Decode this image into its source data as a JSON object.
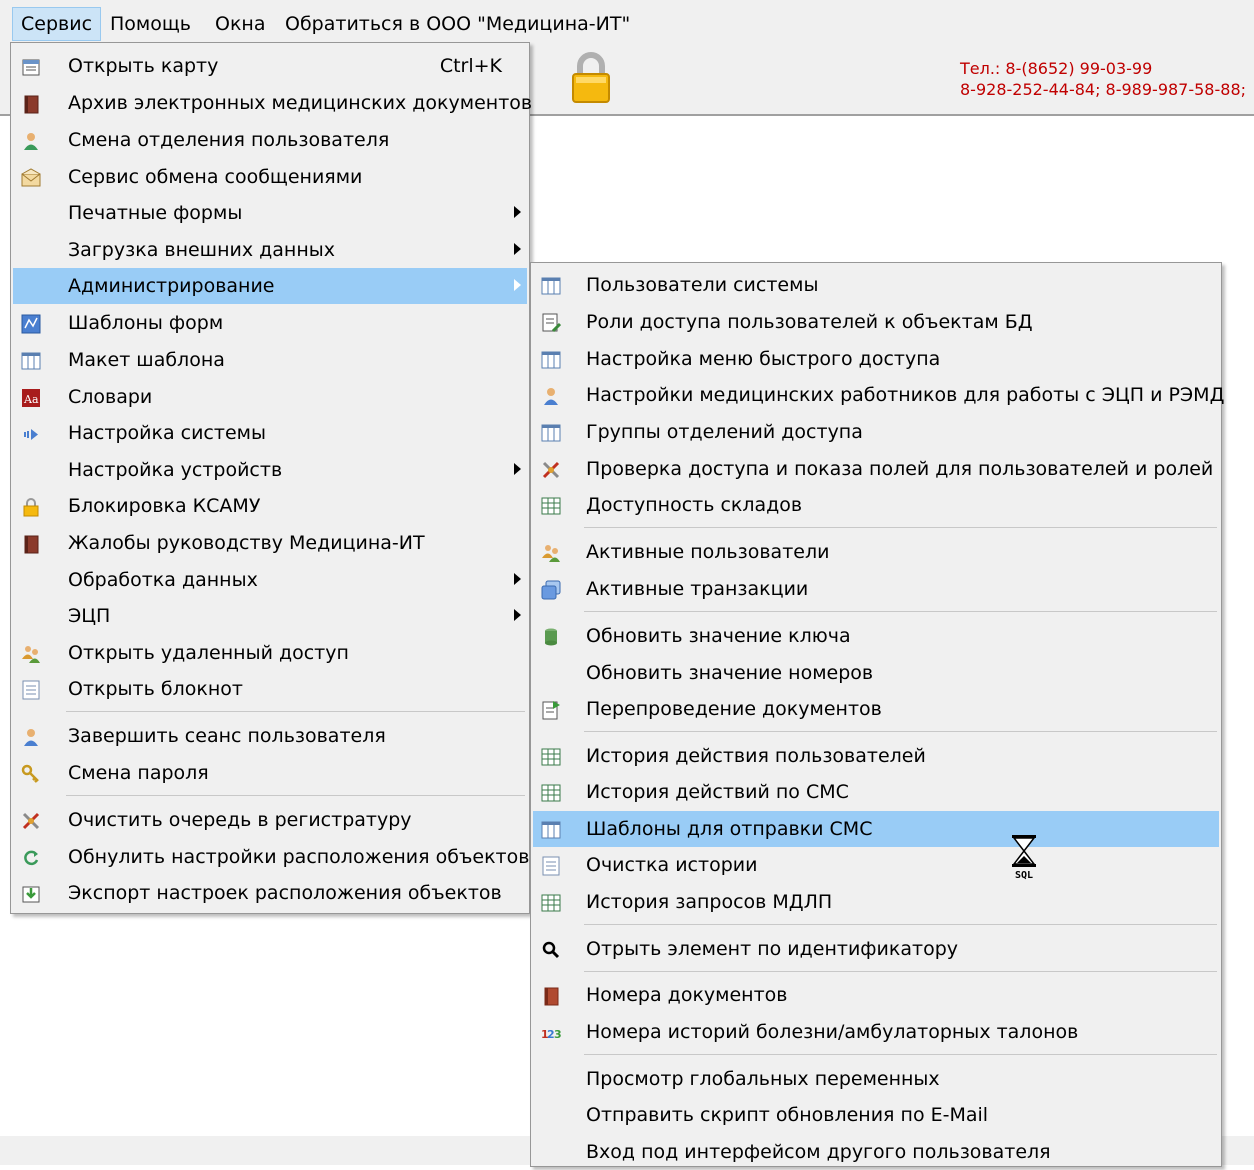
{
  "menubar": {
    "items": [
      "Сервис",
      "Помощь",
      "Окна",
      "Обратиться в ООО \"Медицина-ИТ\""
    ]
  },
  "contact": {
    "line1": "Тел.: 8-(8652) 99-03-99",
    "line2": "8-928-252-44-84; 8-989-987-58-88;"
  },
  "main_menu": {
    "items": [
      {
        "label": "Открыть карту",
        "shortcut": "Ctrl+K",
        "icon": "open-card-icon"
      },
      {
        "label": "Архив электронных медицинских документов",
        "icon": "book-icon"
      },
      {
        "label": "Смена отделения пользователя",
        "icon": "user-icon"
      },
      {
        "label": "Сервис обмена сообщениями",
        "icon": "envelope-icon"
      },
      {
        "label": "Печатные формы",
        "submenu": true
      },
      {
        "label": "Загрузка внешних данных",
        "submenu": true
      },
      {
        "label": "Администрирование",
        "submenu": true,
        "highlighted": true
      },
      {
        "label": "Шаблоны форм",
        "icon": "form-template-icon"
      },
      {
        "label": "Макет шаблона",
        "icon": "grid-icon"
      },
      {
        "label": "Словари",
        "icon": "dictionary-icon"
      },
      {
        "label": "Настройка системы",
        "icon": "arrow-right-icon"
      },
      {
        "label": "Настройка устройств",
        "submenu": true
      },
      {
        "label": "Блокировка КСАМУ",
        "icon": "lock-icon"
      },
      {
        "label": "Жалобы руководству Медицина-ИТ",
        "icon": "book-icon"
      },
      {
        "label": "Обработка данных",
        "submenu": true
      },
      {
        "label": "ЭЦП",
        "submenu": true
      },
      {
        "label": "Открыть удаленный доступ",
        "icon": "users-icon"
      },
      {
        "label": "Открыть блокнот",
        "icon": "notepad-icon"
      },
      {
        "label": "Завершить сеанс пользователя",
        "icon": "user-icon"
      },
      {
        "label": "Смена пароля",
        "icon": "key-icon"
      },
      {
        "label": "Очистить очередь в регистратуру",
        "icon": "tools-icon"
      },
      {
        "label": "Обнулить настройки расположения объектов",
        "icon": "refresh-icon"
      },
      {
        "label": "Экспорт настроек расположения объектов",
        "icon": "export-icon"
      }
    ]
  },
  "admin_submenu": {
    "items": [
      {
        "label": "Пользователи системы",
        "icon": "grid-icon"
      },
      {
        "label": "Роли доступа пользователей к объектам БД",
        "icon": "edit-doc-icon"
      },
      {
        "label": "Настройка меню быстрого доступа",
        "icon": "grid-icon"
      },
      {
        "label": "Настройки медицинских работников для работы с ЭЦП и РЭМД",
        "icon": "user-icon"
      },
      {
        "label": "Группы отделений доступа",
        "icon": "grid-icon"
      },
      {
        "label": "Проверка доступа и показа полей для пользователей и ролей",
        "icon": "tools-icon"
      },
      {
        "label": "Доступность складов",
        "icon": "table-icon"
      },
      {
        "label": "Активные пользователи",
        "icon": "users-icon"
      },
      {
        "label": "Активные транзакции",
        "icon": "windows-icon"
      },
      {
        "label": "Обновить значение ключа",
        "icon": "database-icon"
      },
      {
        "label": "Обновить значение номеров"
      },
      {
        "label": "Перепроведение документов",
        "icon": "repost-icon"
      },
      {
        "label": "История действия пользователей",
        "icon": "table-icon"
      },
      {
        "label": "История действий по СМС",
        "icon": "table-icon"
      },
      {
        "label": "Шаблоны для отправки СМС",
        "icon": "grid-icon",
        "highlighted": true
      },
      {
        "label": "Очистка истории",
        "icon": "notepad-icon"
      },
      {
        "label": "История запросов МДЛП",
        "icon": "table-icon"
      },
      {
        "label": "Отрыть элемент по идентификатору",
        "icon": "search-icon"
      },
      {
        "label": "Номера документов",
        "icon": "book-icon"
      },
      {
        "label": "Номера историй болезни/амбулаторных талонов",
        "icon": "numbers-icon"
      },
      {
        "label": "Просмотр глобальных переменных"
      },
      {
        "label": "Отправить скрипт обновления по E-Mail"
      },
      {
        "label": "Вход под интерфейсом другого пользователя"
      }
    ]
  },
  "cursor": {
    "label": "SQL",
    "icon": "hourglass-sql-cursor-icon"
  },
  "colors": {
    "highlight": "#99ccf6",
    "menubar_active": "#cce4f7",
    "contact_text": "#c00000"
  }
}
